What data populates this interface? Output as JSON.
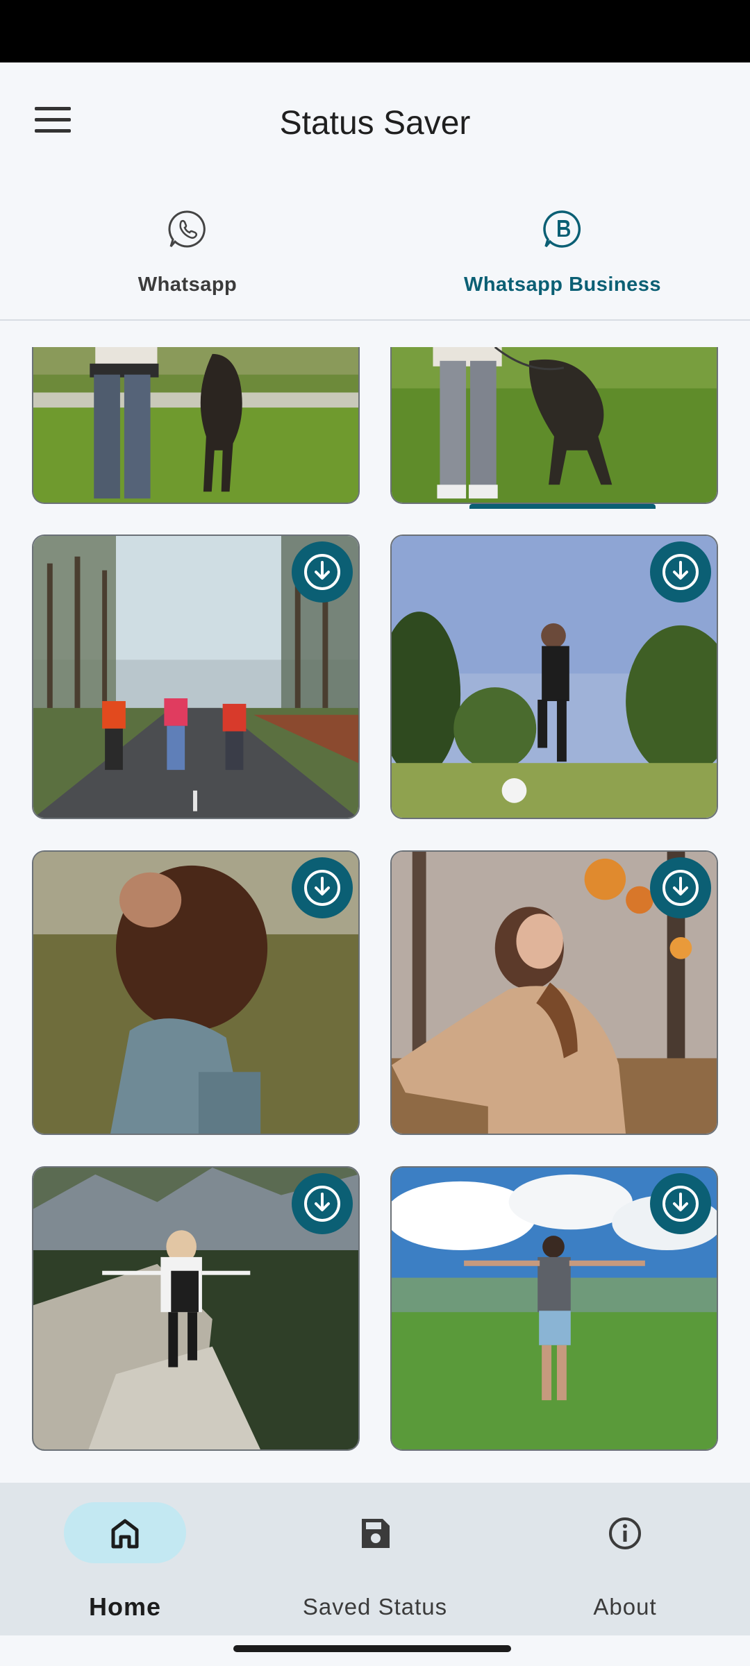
{
  "app_bar": {
    "title": "Status Saver",
    "menu_icon": "hamburger-menu-icon"
  },
  "tabs": [
    {
      "label": "Whatsapp",
      "icon": "whatsapp-icon",
      "selected": false
    },
    {
      "label": "Whatsapp Business",
      "icon": "whatsapp-business-icon",
      "selected": true
    }
  ],
  "statuses": [
    {
      "scene": "man-and-dog-on-grass-left",
      "download_icon": "download-icon"
    },
    {
      "scene": "man-and-dog-on-grass-right",
      "download_icon": "download-icon"
    },
    {
      "scene": "three-people-on-misty-road",
      "download_icon": "download-icon"
    },
    {
      "scene": "person-kicking-soccer-ball",
      "download_icon": "download-icon"
    },
    {
      "scene": "curly-haired-woman-in-field",
      "download_icon": "download-icon"
    },
    {
      "scene": "woman-with-autumn-leaves",
      "download_icon": "download-icon"
    },
    {
      "scene": "hiker-with-backpack-on-mountain-trail",
      "download_icon": "download-icon"
    },
    {
      "scene": "man-arms-open-on-green-valley",
      "download_icon": "download-icon"
    }
  ],
  "bottom_nav": [
    {
      "label": "Home",
      "icon": "home-icon",
      "selected": true
    },
    {
      "label": "Saved Status",
      "icon": "save-icon",
      "selected": false
    },
    {
      "label": "About",
      "icon": "info-icon",
      "selected": false
    }
  ],
  "colors": {
    "accent": "#0b5f74",
    "nav_selected_pill": "#c3e8f2",
    "nav_background": "#dfe5ea",
    "background": "#f5f7fa"
  }
}
